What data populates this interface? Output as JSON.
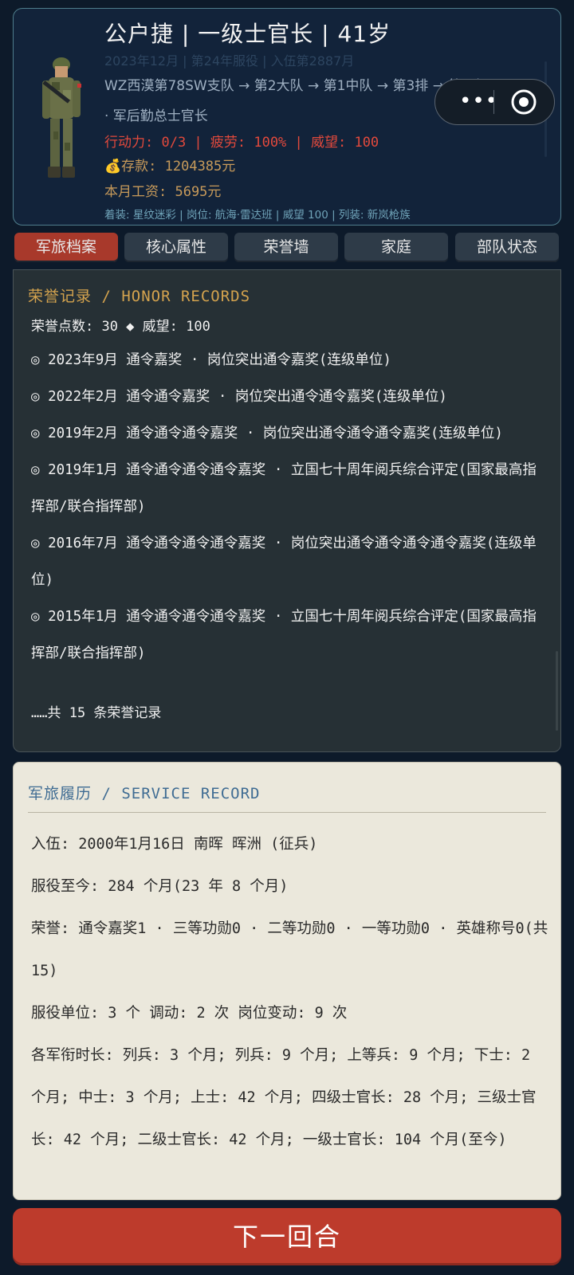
{
  "profile": {
    "title": "公户捷  |  一级士官长  |  41岁",
    "faded_line": "2023年12月  |  第24年服役  |  入伍第2887月",
    "unit_path": "WZ西漠第78SW支队 → 第2大队 → 第1中队 → 第3排 → 第3班",
    "unit_path_2": "· 军后勤总士官长",
    "stats": "行动力: 0/3  |  疲劳: 100%  |  威望: 100",
    "savings": "💰存款: 1204385元",
    "salary": "本月工资: 5695元",
    "equipment": "着装: 星纹迷彩 | 岗位: 航海·雷达班 | 威望 100 | 列装: 新岚枪族"
  },
  "capsule": {
    "more_label": "•••"
  },
  "tabs": [
    {
      "label": "军旅档案"
    },
    {
      "label": "核心属性"
    },
    {
      "label": "荣誉墙"
    },
    {
      "label": "家庭"
    },
    {
      "label": "部队状态"
    }
  ],
  "honor": {
    "title": "荣誉记录 / HONOR RECORDS",
    "points_line": "荣誉点数: 30 ◆  威望: 100",
    "items": [
      {
        "text": "◎ 2023年9月 通令嘉奖 · 岗位突出通令嘉奖(连级单位)"
      },
      {
        "text": "◎ 2022年2月 通令通令嘉奖 · 岗位突出通令通令嘉奖(连级单位)"
      },
      {
        "text": "◎ 2019年2月 通令通令通令嘉奖 · 岗位突出通令通令通令嘉奖(连级单位)"
      },
      {
        "text": "◎ 2019年1月 通令通令通令通令嘉奖 · 立国七十周年阅兵综合评定(国家最高指挥部/联合指挥部)"
      },
      {
        "text": "◎ 2016年7月 通令通令通令通令嘉奖 · 岗位突出通令通令通令通令嘉奖(连级单位)"
      },
      {
        "text": "◎ 2015年1月 通令通令通令通令嘉奖 · 立国七十周年阅兵综合评定(国家最高指挥部/联合指挥部)"
      }
    ],
    "more": "……共 15 条荣誉记录"
  },
  "service": {
    "title": "军旅履历 / SERVICE RECORD",
    "enlist": "入伍: 2000年1月16日  南晖 晖洲  (征兵)",
    "duration": "服役至今: 284 个月(23 年 8 个月)",
    "honors": "荣誉: 通令嘉奖1 · 三等功勋0 · 二等功勋0 · 一等功勋0 · 英雄称号0(共15)",
    "units": "服役单位: 3 个  调动: 2 次  岗位变动: 9 次",
    "rank_times": "各军衔时长: 列兵: 3 个月; 列兵: 9 个月; 上等兵: 9 个月; 下士: 2 个月; 中士: 3 个月; 上士: 42 个月; 四级士官长: 28 个月; 三级士官长: 42 个月; 二级士官长: 42 个月; 一级士官长: 104 个月(至今)"
  },
  "next_button": {
    "label": "下一回合"
  },
  "colors": {
    "background": "#0d1a2a",
    "active_tab": "#a8392b",
    "next_button": "#bd3b2c",
    "honor_title": "#d4a34e",
    "stats_red": "#e2493c",
    "money_gold": "#c79a5a"
  }
}
